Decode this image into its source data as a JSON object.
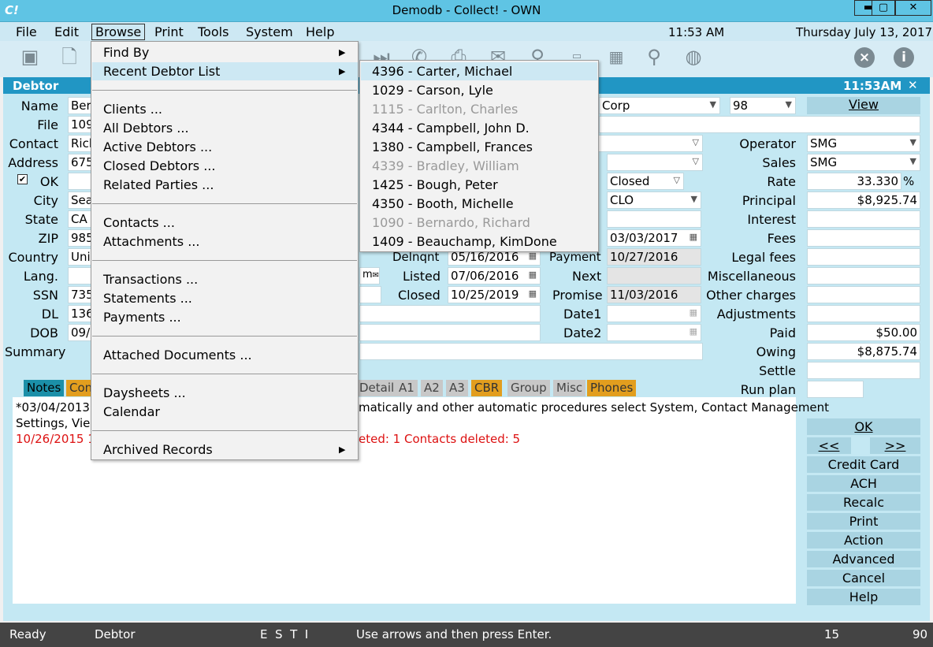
{
  "window": {
    "logo": "C!",
    "title": "Demodb - Collect! - OWN",
    "min": "▬",
    "max": "▢",
    "close": "✕"
  },
  "menubar": {
    "items": [
      "File",
      "Edit",
      "Browse",
      "Print",
      "Tools",
      "System",
      "Help"
    ],
    "clock": "11:53 AM",
    "date": "Thursday  July 13, 2017"
  },
  "debtor_window": {
    "title": "Debtor",
    "time": "11:53AM",
    "close": "✕"
  },
  "left_labels": {
    "name": "Name",
    "file": "File",
    "contact": "Contact",
    "address": "Address",
    "ok": "OK",
    "city": "City",
    "state": "State",
    "zip": "ZIP",
    "country": "Country",
    "lang": "Lang.",
    "ssn": "SSN",
    "dl": "DL",
    "dob": "DOB",
    "summary": "Summary"
  },
  "left_values": {
    "name": "Ber",
    "file": "109",
    "contact": "Rich",
    "address": "675",
    "city": "Sea",
    "state": "CA",
    "zip": "985",
    "country": "Uni",
    "ssn": "735",
    "dl": "136",
    "dob": "09/0"
  },
  "mid": {
    "client": "Corp",
    "client_num": "98",
    "view": "View",
    "status": "Closed",
    "class": "CLO",
    "dates_labels": {
      "delinquent": "Delnqnt",
      "listed": "Listed",
      "closed": "Closed",
      "payment": "Payment",
      "next": "Next",
      "promise": "Promise",
      "date1": "Date1",
      "date2": "Date2"
    },
    "dates": {
      "received": "03/03/2017",
      "delinquent": "05/16/2016",
      "listed": "07/06/2016",
      "closed": "10/25/2019",
      "payment": "10/27/2016",
      "next": "",
      "promise": "11/03/2016",
      "date1": "",
      "date2": ""
    },
    "email_frag": "m"
  },
  "right": {
    "labels": {
      "operator": "Operator",
      "sales": "Sales",
      "rate": "Rate",
      "principal": "Principal",
      "interest": "Interest",
      "fees": "Fees",
      "legal": "Legal fees",
      "misc": "Miscellaneous",
      "other": "Other charges",
      "adj": "Adjustments",
      "paid": "Paid",
      "owing": "Owing",
      "settle": "Settle",
      "runplan": "Run plan"
    },
    "values": {
      "operator": "SMG",
      "sales": "SMG",
      "rate": "33.330",
      "rate_unit": "%",
      "principal": "$8,925.74",
      "paid": "$50.00",
      "owing": "$8,875.74"
    }
  },
  "tabs": [
    "Notes",
    "Con",
    "Detail",
    "A1",
    "A2",
    "A3",
    "CBR",
    "Group",
    "Misc",
    "Phones"
  ],
  "notes": {
    "line1a": "*03/04/2013 1",
    "line1b": "matically and other automatic procedures select System, Contact Management",
    "line2": "Settings, View",
    "line3a": "10/26/2015 1",
    "line3b": "eted: 1 Contacts deleted: 5"
  },
  "buttons": {
    "ok": "OK",
    "prev": "<<",
    "next": ">>",
    "credit": "Credit Card",
    "ach": "ACH",
    "recalc": "Recalc",
    "print": "Print",
    "action": "Action",
    "advanced": "Advanced",
    "cancel": "Cancel",
    "help": "Help"
  },
  "statusbar": {
    "ready": "Ready",
    "form": "Debtor",
    "flags": "E  S  T  I",
    "hint": "Use arrows and then press Enter.",
    "n1": "15",
    "n2": "90"
  },
  "browse_menu": {
    "find_by": "Find By",
    "recent": "Recent Debtor List",
    "clients": "Clients ...",
    "all_debtors": "All Debtors ...",
    "active_debtors": "Active Debtors ...",
    "closed_debtors": "Closed Debtors ...",
    "related": "Related Parties ...",
    "contacts": "Contacts ...",
    "attachments": "Attachments ...",
    "transactions": "Transactions ...",
    "statements": "Statements ...",
    "payments": "Payments ...",
    "attached_docs": "Attached Documents ...",
    "daysheets": "Daysheets ...",
    "calendar": "Calendar",
    "archived": "Archived Records"
  },
  "recent_list": [
    "4396 - Carter, Michael",
    "1029 - Carson, Lyle",
    "1115 - Carlton, Charles",
    "4344 - Campbell, John D.",
    "1380 - Campbell, Frances",
    "4339 - Bradley, William",
    "1425 - Bough, Peter",
    "4350 - Booth, Michelle",
    "1090 - Bernardo, Richard",
    "1409 - Beauchamp, KimDone"
  ],
  "toolbar_icons": [
    "save-icon",
    "new-file-icon",
    "next-icon",
    "phone-icon",
    "print-icon",
    "email-icon",
    "search-icon",
    "visa-card-icon",
    "calendar-icon",
    "search-magnifier-icon",
    "globe-icon",
    "close-circle-icon",
    "info-icon"
  ]
}
